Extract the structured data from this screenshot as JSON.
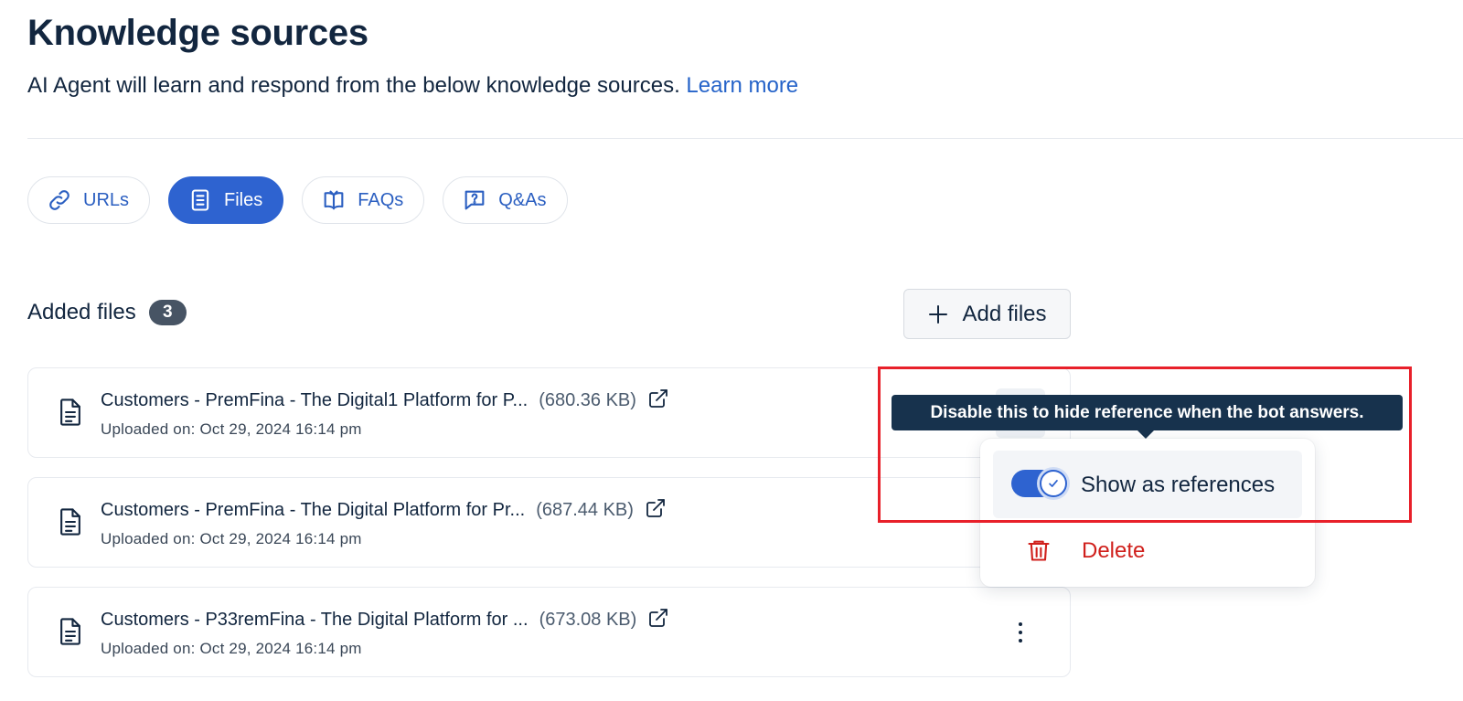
{
  "header": {
    "title": "Knowledge sources",
    "subtitle": "AI Agent will learn and respond from the below knowledge sources.",
    "learn_more": "Learn more"
  },
  "tabs": [
    {
      "label": "URLs",
      "icon": "link-icon",
      "active": false
    },
    {
      "label": "Files",
      "icon": "document-icon",
      "active": true
    },
    {
      "label": "FAQs",
      "icon": "book-icon",
      "active": false
    },
    {
      "label": "Q&As",
      "icon": "question-chat-icon",
      "active": false
    }
  ],
  "files_section": {
    "label": "Added files",
    "count": "3",
    "add_button": "Add files"
  },
  "files": [
    {
      "name": "Customers - PremFina - The Digital1 Platform for P...",
      "size": "(680.36 KB)",
      "uploaded": "Uploaded on: Oct 29, 2024 16:14 pm"
    },
    {
      "name": "Customers - PremFina - The Digital Platform for Pr...",
      "size": "(687.44 KB)",
      "uploaded": "Uploaded on: Oct 29, 2024 16:14 pm"
    },
    {
      "name": "Customers - P33remFina - The Digital Platform for ...",
      "size": "(673.08 KB)",
      "uploaded": "Uploaded on: Oct 29, 2024 16:14 pm"
    }
  ],
  "context_menu": {
    "tooltip": "Disable this to hide reference when the bot answers.",
    "show_references_label": "Show as references",
    "show_references_enabled": true,
    "delete_label": "Delete"
  },
  "colors": {
    "accent": "#2e63d0",
    "link": "#2563c9",
    "text": "#12263f",
    "danger": "#d0201c",
    "highlight": "#e8202a",
    "tooltip_bg": "#17324d"
  }
}
